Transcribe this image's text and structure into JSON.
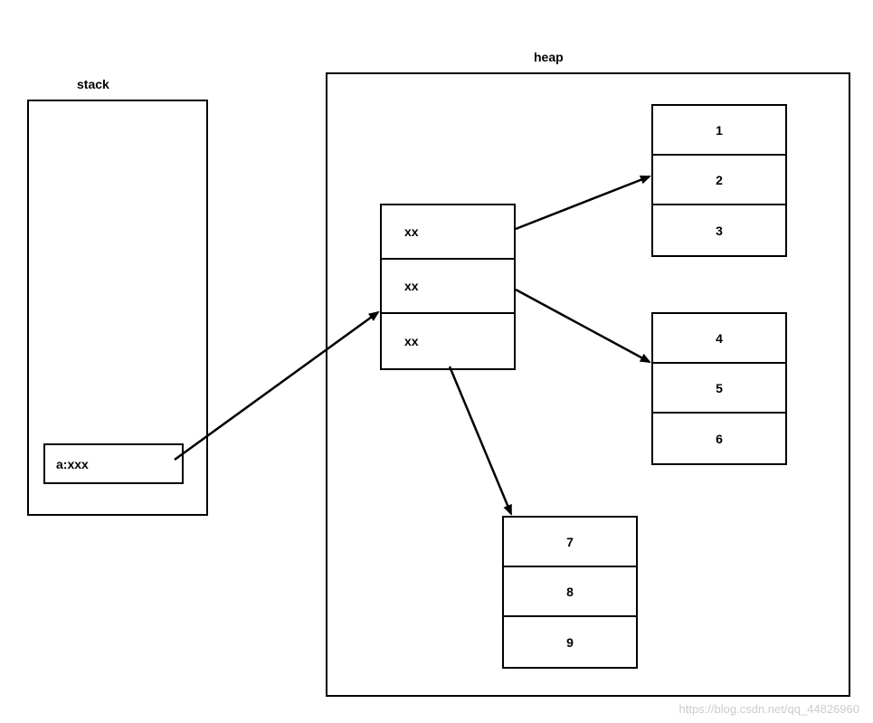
{
  "titles": {
    "stack": "stack",
    "heap": "heap"
  },
  "stack": {
    "var": "a:xxx"
  },
  "midArray": {
    "c0": "xx",
    "c1": "xx",
    "c2": "xx"
  },
  "arrays": {
    "a1": {
      "v0": "1",
      "v1": "2",
      "v2": "3"
    },
    "a2": {
      "v0": "4",
      "v1": "5",
      "v2": "6"
    },
    "a3": {
      "v0": "7",
      "v1": "8",
      "v2": "9"
    }
  },
  "watermark": "https://blog.csdn.net/qq_44826960"
}
